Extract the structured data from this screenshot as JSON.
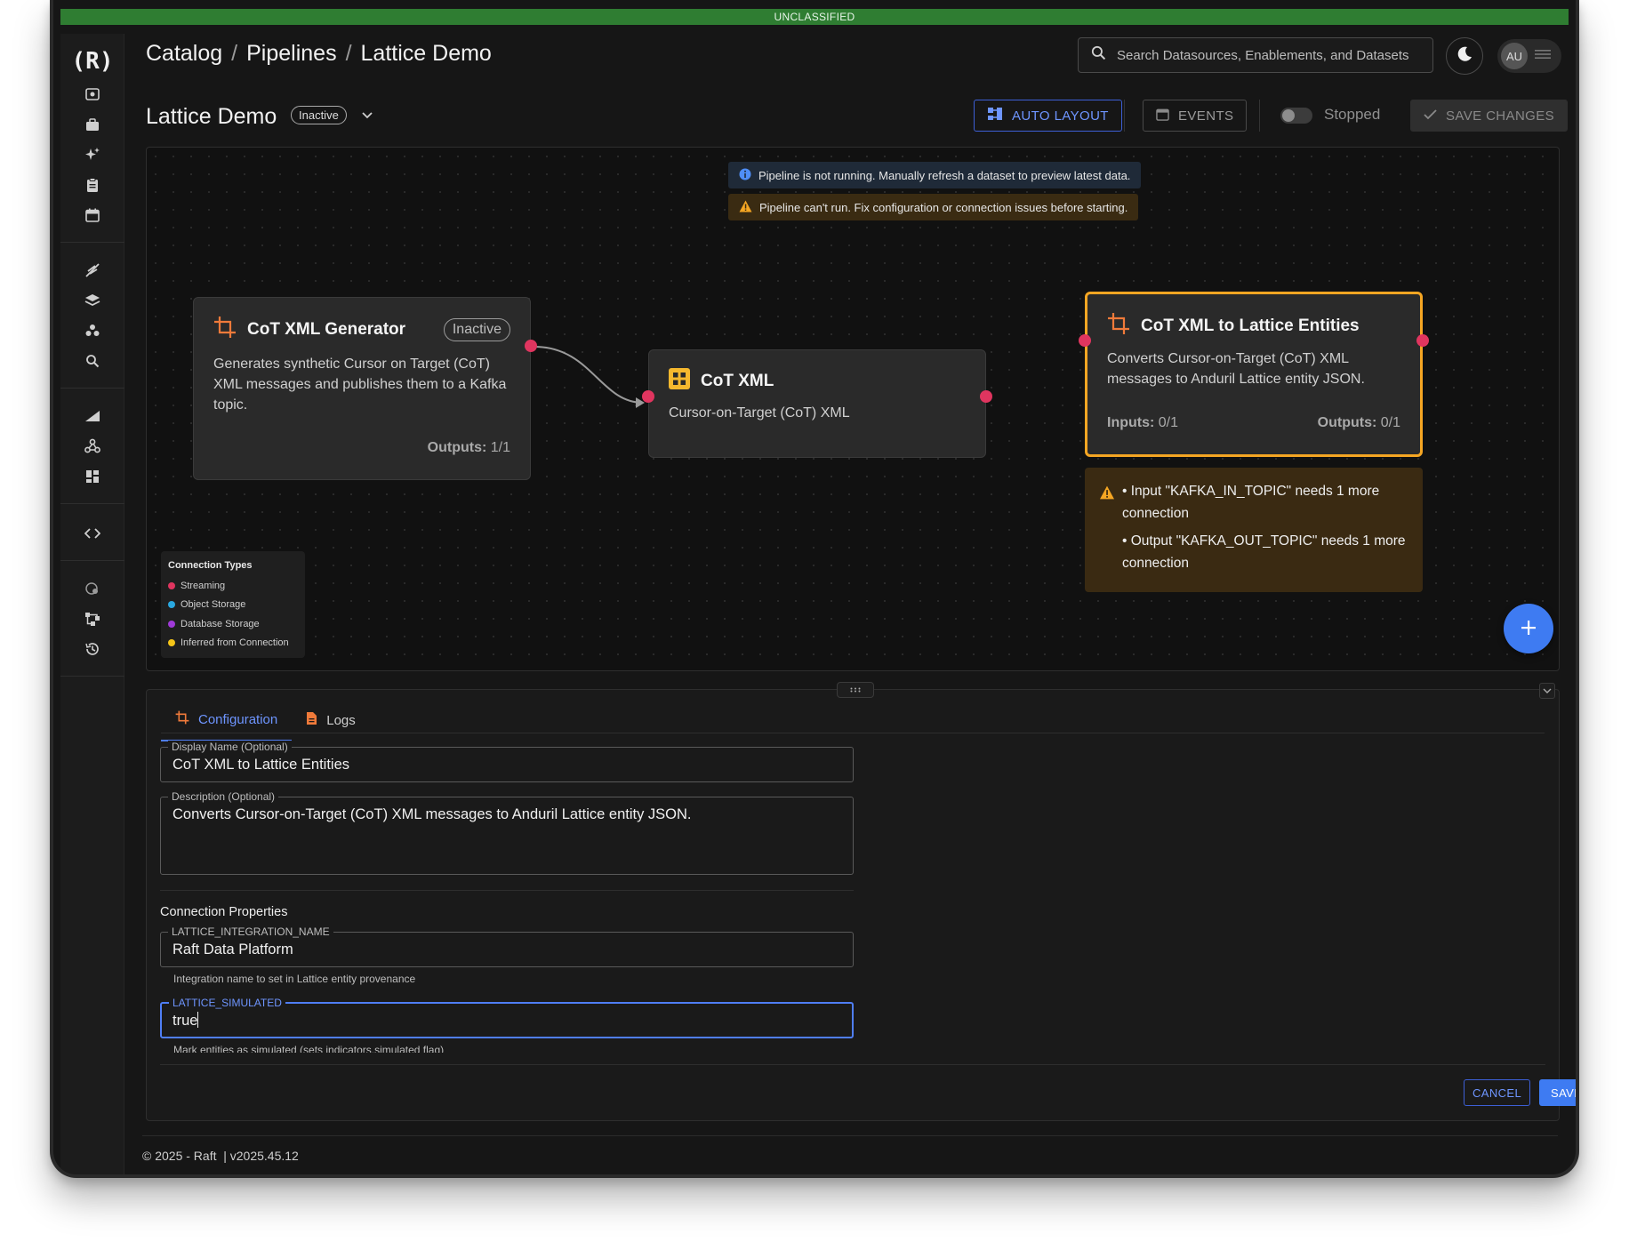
{
  "classification": "UNCLASSIFIED",
  "logo": "(R)",
  "breadcrumb": {
    "items": [
      "Catalog",
      "Pipelines",
      "Lattice Demo"
    ],
    "separator": "/"
  },
  "search": {
    "placeholder": "Search Datasources, Enablements, and Datasets"
  },
  "user": {
    "initials": "AU"
  },
  "pipeline": {
    "title": "Lattice Demo",
    "status": "Inactive",
    "auto_layout_label": "AUTO LAYOUT",
    "events_label": "EVENTS",
    "run_state_label": "Stopped",
    "save_changes_label": "SAVE CHANGES"
  },
  "alerts": {
    "info": "Pipeline is not running. Manually refresh a dataset to preview latest data.",
    "warning": "Pipeline can't run. Fix configuration or connection issues before starting."
  },
  "nodes": {
    "generator": {
      "title": "CoT XML Generator",
      "status": "Inactive",
      "description": "Generates synthetic Cursor on Target (CoT) XML messages and publishes them to a Kafka topic.",
      "outputs_label": "Outputs:",
      "outputs_value": "1/1"
    },
    "dataset": {
      "title": "CoT XML",
      "description": "Cursor-on-Target (CoT) XML"
    },
    "transform": {
      "title": "CoT XML to Lattice Entities",
      "description": "Converts Cursor-on-Target (CoT) XML messages to Anduril Lattice entity JSON.",
      "inputs_label": "Inputs:",
      "inputs_value": "0/1",
      "outputs_label": "Outputs:",
      "outputs_value": "0/1",
      "warnings": [
        "• Input \"KAFKA_IN_TOPIC\" needs 1 more connection",
        "• Output \"KAFKA_OUT_TOPIC\" needs 1 more connection"
      ]
    }
  },
  "legend": {
    "title": "Connection Types",
    "items": [
      {
        "label": "Streaming",
        "color": "#e0355f"
      },
      {
        "label": "Object Storage",
        "color": "#29a8e0"
      },
      {
        "label": "Database Storage",
        "color": "#a03ad8"
      },
      {
        "label": "Inferred from Connection",
        "color": "#f5c518"
      }
    ]
  },
  "panel": {
    "tabs": [
      "Configuration",
      "Logs"
    ],
    "display_name": {
      "label": "Display Name (Optional)",
      "value": "CoT XML to Lattice Entities"
    },
    "description": {
      "label": "Description (Optional)",
      "value": "Converts Cursor-on-Target (CoT) XML messages to Anduril Lattice entity JSON."
    },
    "connection_properties_title": "Connection Properties",
    "integration_name": {
      "label": "LATTICE_INTEGRATION_NAME",
      "value": "Raft Data Platform",
      "hint": "Integration name to set in Lattice entity provenance"
    },
    "simulated": {
      "label": "LATTICE_SIMULATED",
      "value": "true",
      "hint": "Mark entities as simulated (sets indicators.simulated flag)"
    },
    "cancel_label": "CANCEL",
    "save_label": "SAVE"
  },
  "footer": {
    "text": "© 2025 - Raft  | v2025.45.12"
  },
  "colors": {
    "accent": "#3e7bf2",
    "warning_border": "#f5a623",
    "port": "#e0355f",
    "classification_bg": "#2f7d32"
  }
}
